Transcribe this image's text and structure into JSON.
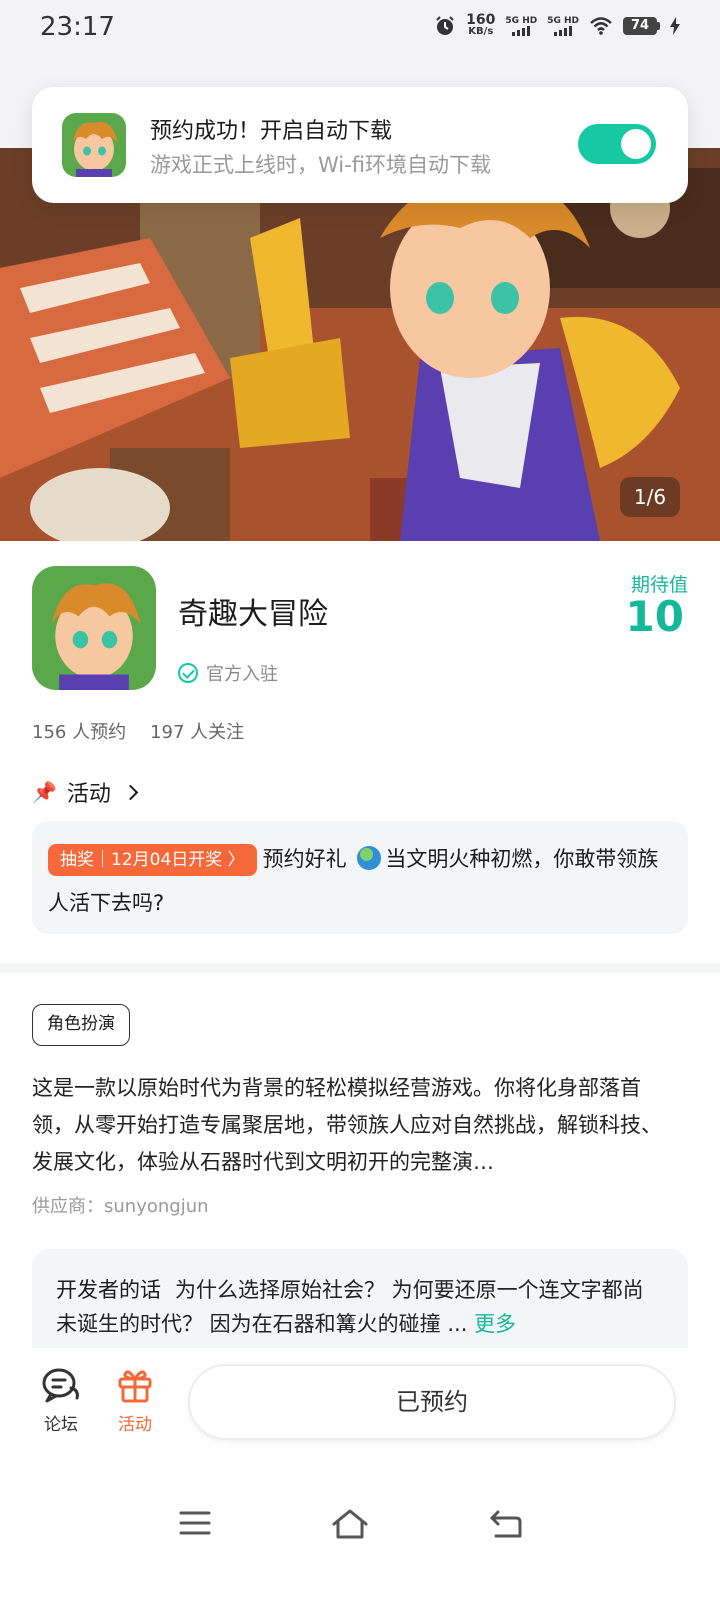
{
  "status_bar": {
    "time": "23:17",
    "net_speed_value": "160",
    "net_speed_unit": "KB/s",
    "sim1": "5G HD",
    "sim2": "5G HD",
    "battery": "74"
  },
  "toast": {
    "title": "预约成功！开启自动下载",
    "subtitle": "游戏正式上线时，Wi-fi环境自动下载",
    "toggle_on": true,
    "accent": "#16c9a4"
  },
  "hero": {
    "pager": "1/6"
  },
  "game": {
    "name": "奇趣大冒险",
    "official": "官方入驻",
    "expect_label": "期待值",
    "expect_value": "10",
    "reservations": "156 人预约",
    "followers": "197 人关注"
  },
  "activity": {
    "heading": "活动",
    "tag": "抽奖｜12月04日开奖 〉",
    "text_before": "预约好礼 ",
    "text_after": "当文明火种初燃，你敢带领族人活下去吗?"
  },
  "details": {
    "genre": "角色扮演",
    "description": "这是一款以原始时代为背景的轻松模拟经营游戏。你将化身部落首领，从零开始打造专属聚居地，带领族人应对自然挑战，解锁科技、发展文化，体验从石器时代到文明初开的完整演…",
    "supplier": "供应商：sunyongjun"
  },
  "developer": {
    "label": "开发者的话",
    "text": "为什么选择原始社会？ 为何要还原一个连文字都尚未诞生的时代？ 因为在石器和篝火的碰撞 ...",
    "more": "更多"
  },
  "bottom_bar": {
    "forum_label": "论坛",
    "activity_label": "活动",
    "reserve_button": "已预约"
  },
  "colors": {
    "accent": "#16b89a",
    "orange": "#f5683a"
  }
}
